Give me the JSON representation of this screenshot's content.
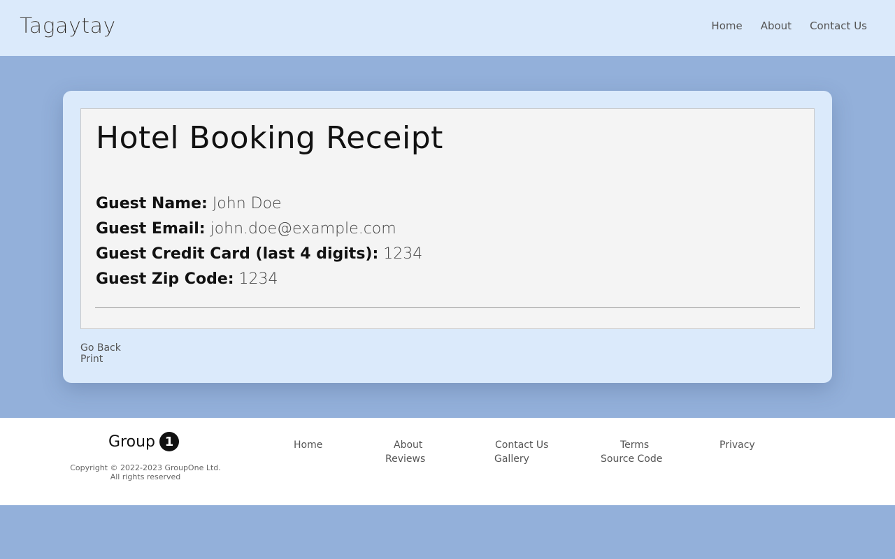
{
  "header": {
    "brand": "Tagaytay",
    "nav": [
      "Home",
      "About",
      "Contact Us"
    ]
  },
  "receipt": {
    "title": "Hotel Booking Receipt",
    "fields": [
      {
        "label": "Guest Name:",
        "value": "John Doe"
      },
      {
        "label": "Guest Email:",
        "value": "john.doe@example.com"
      },
      {
        "label": "Guest Credit Card (last 4 digits):",
        "value": "1234"
      },
      {
        "label": "Guest Zip Code:",
        "value": "1234"
      }
    ],
    "actions": {
      "back": "Go Back",
      "print": "Print"
    }
  },
  "footer": {
    "logo_text": "Group",
    "logo_number": "1",
    "copyright": "Copyright © 2022-2023 GroupOne Ltd. All rights reserved",
    "links": {
      "home": "Home",
      "about": "About",
      "contact": "Contact Us",
      "terms": "Terms",
      "privacy": "Privacy",
      "reviews": "Reviews",
      "gallery": "Gallery",
      "source": "Source Code"
    }
  },
  "colors": {
    "page_bg": "#93b0da",
    "header_bg": "#dbeafb",
    "card_bg": "#dbeafb",
    "receipt_bg": "#f4f4f4",
    "footer_bg": "#ffffff"
  }
}
